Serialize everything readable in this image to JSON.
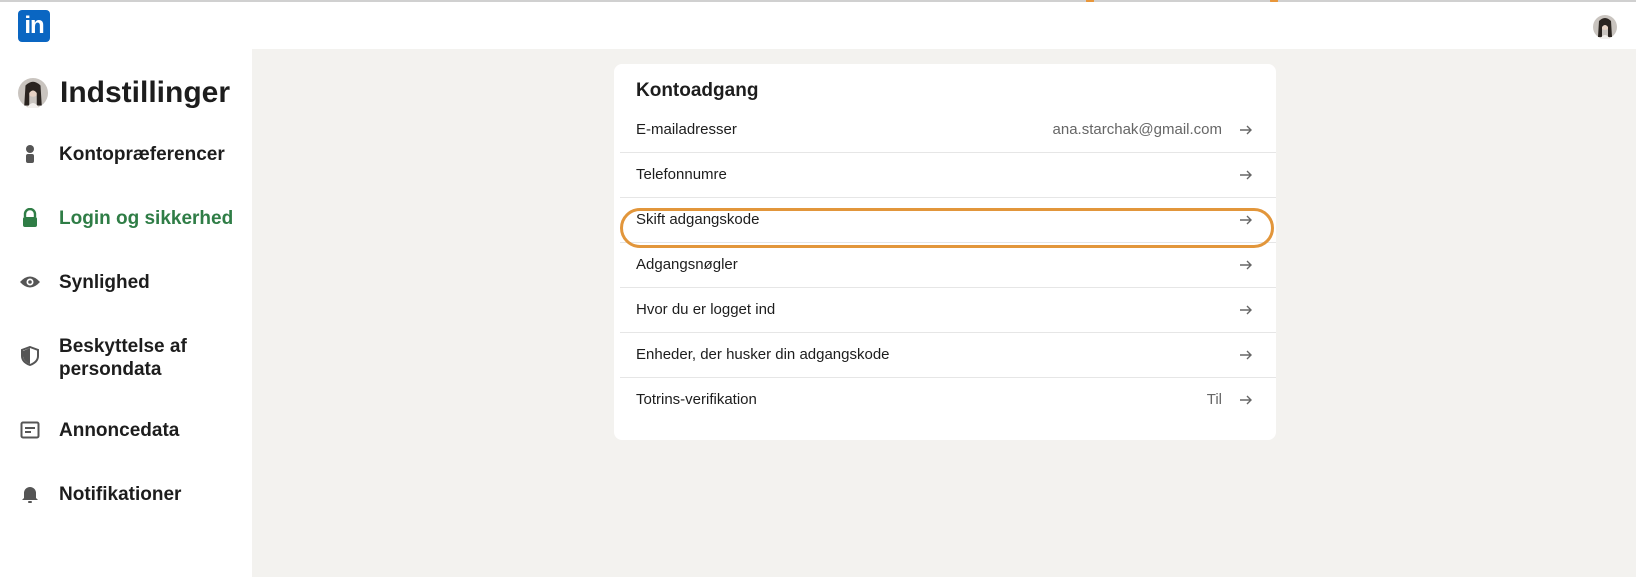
{
  "app": {
    "logo_text": "in",
    "logo_color": "#0a66c2"
  },
  "sidebar": {
    "title": "Indstillinger",
    "items": [
      {
        "label": "Kontopræferencer",
        "icon": "person-icon",
        "active": false
      },
      {
        "label": "Login og sikkerhed",
        "icon": "lock-icon",
        "active": true
      },
      {
        "label": "Synlighed",
        "icon": "eye-icon",
        "active": false
      },
      {
        "label": "Beskyttelse af persondata",
        "icon": "shield-icon",
        "active": false
      },
      {
        "label": "Annoncedata",
        "icon": "ad-card-icon",
        "active": false
      },
      {
        "label": "Notifikationer",
        "icon": "bell-icon",
        "active": false
      }
    ],
    "active_color": "#2f7d46"
  },
  "card": {
    "title": "Kontoadgang",
    "rows": [
      {
        "label": "E-mailadresser",
        "value": "ana.starchak@gmail.com"
      },
      {
        "label": "Telefonnumre",
        "value": ""
      },
      {
        "label": "Skift adgangskode",
        "value": "",
        "highlighted": true
      },
      {
        "label": "Adgangsnøgler",
        "value": ""
      },
      {
        "label": "Hvor du er logget ind",
        "value": ""
      },
      {
        "label": "Enheder, der husker din adgangskode",
        "value": ""
      },
      {
        "label": "Totrins-verifikation",
        "value": "Til"
      }
    ],
    "highlight_color": "#e2963b"
  }
}
